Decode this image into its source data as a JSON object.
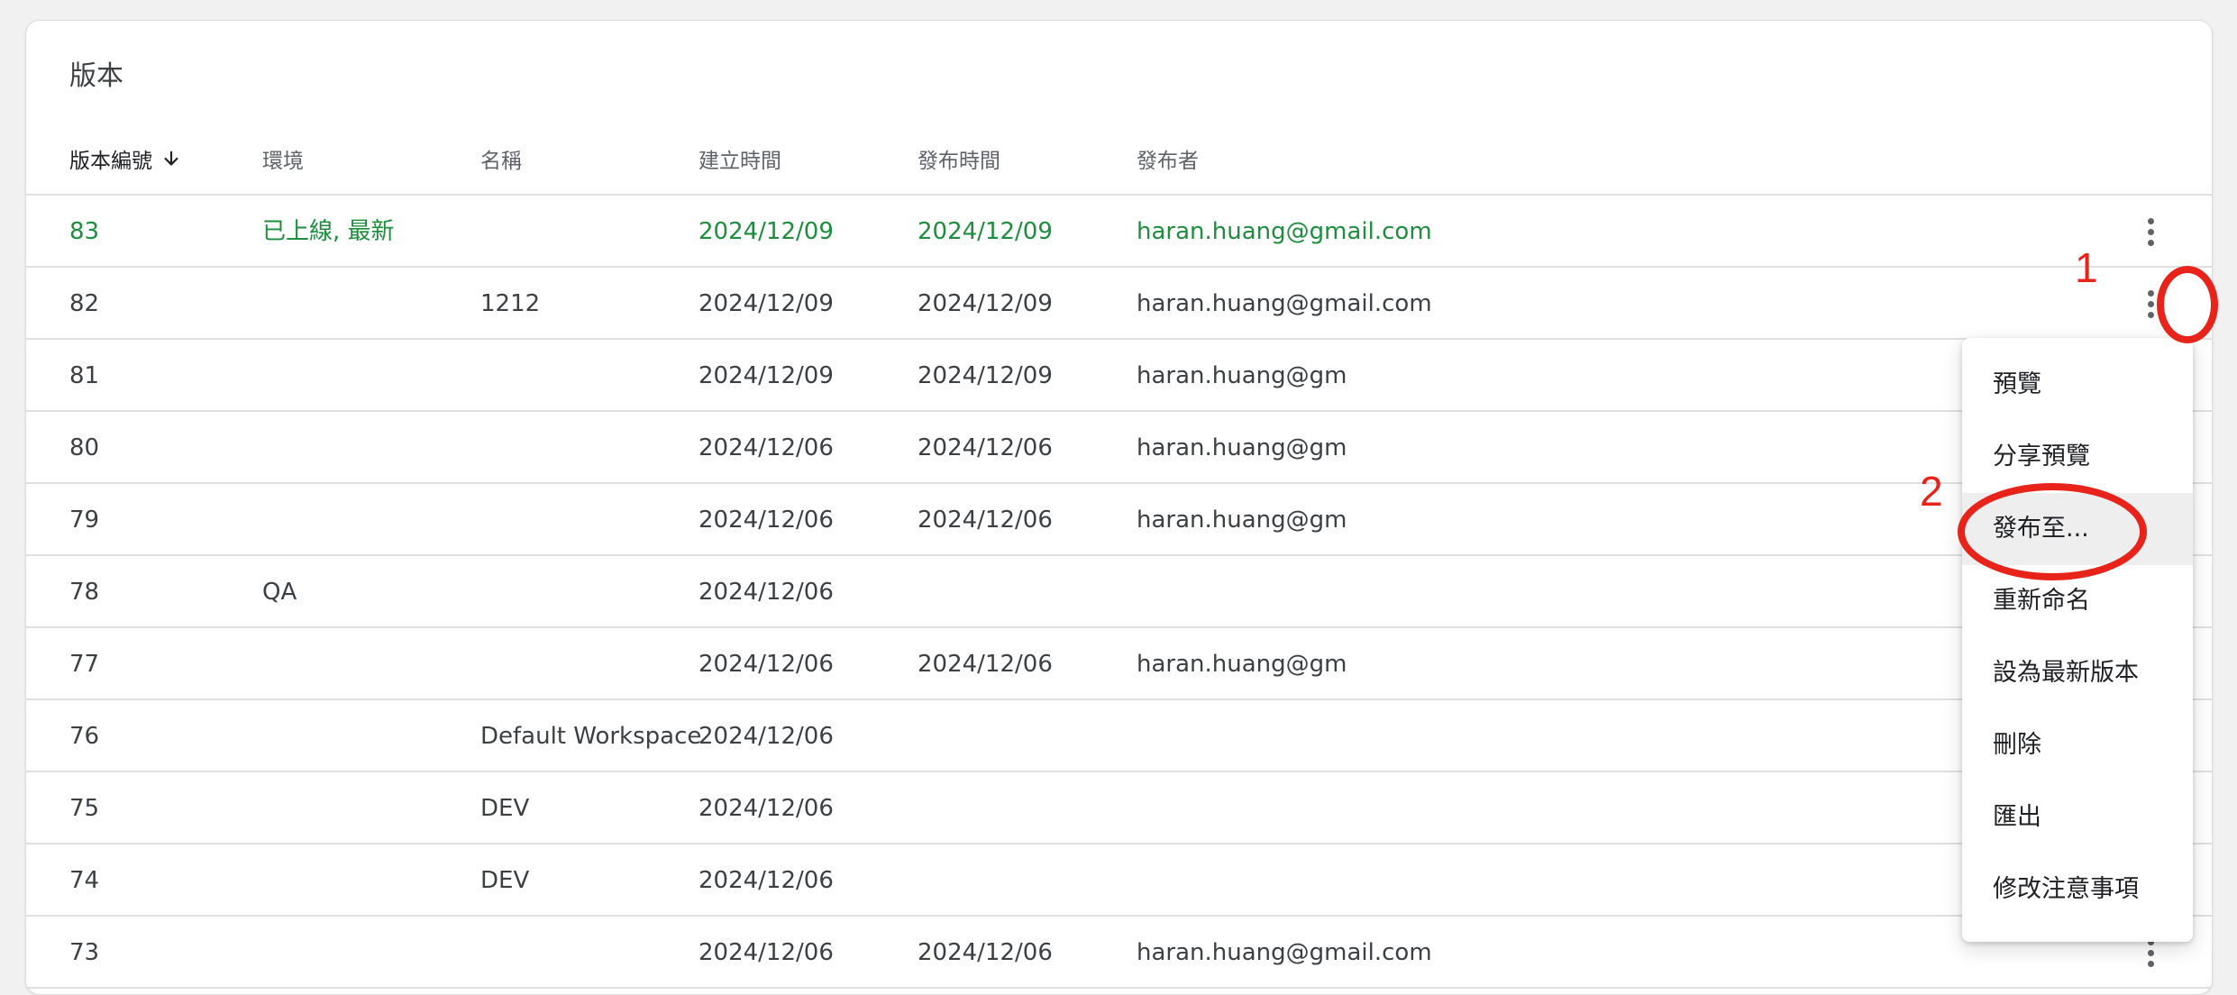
{
  "section_title": "版本",
  "columns": {
    "version": "版本編號",
    "env": "環境",
    "name": "名稱",
    "created": "建立時間",
    "published": "發布時間",
    "publisher": "發布者"
  },
  "rows": [
    {
      "version": "83",
      "env": "已上線, 最新",
      "name": "",
      "created": "2024/12/09",
      "published": "2024/12/09",
      "publisher": "haran.huang@gmail.com",
      "live": true
    },
    {
      "version": "82",
      "env": "",
      "name": "1212",
      "created": "2024/12/09",
      "published": "2024/12/09",
      "publisher": "haran.huang@gmail.com"
    },
    {
      "version": "81",
      "env": "",
      "name": "",
      "created": "2024/12/09",
      "published": "2024/12/09",
      "publisher": "haran.huang@gm"
    },
    {
      "version": "80",
      "env": "",
      "name": "",
      "created": "2024/12/06",
      "published": "2024/12/06",
      "publisher": "haran.huang@gm"
    },
    {
      "version": "79",
      "env": "",
      "name": "",
      "created": "2024/12/06",
      "published": "2024/12/06",
      "publisher": "haran.huang@gm"
    },
    {
      "version": "78",
      "env": "QA",
      "name": "",
      "created": "2024/12/06",
      "published": "",
      "publisher": ""
    },
    {
      "version": "77",
      "env": "",
      "name": "",
      "created": "2024/12/06",
      "published": "2024/12/06",
      "publisher": "haran.huang@gm"
    },
    {
      "version": "76",
      "env": "",
      "name": "Default Workspace",
      "created": "2024/12/06",
      "published": "",
      "publisher": ""
    },
    {
      "version": "75",
      "env": "",
      "name": "DEV",
      "created": "2024/12/06",
      "published": "",
      "publisher": ""
    },
    {
      "version": "74",
      "env": "",
      "name": "DEV",
      "created": "2024/12/06",
      "published": "",
      "publisher": ""
    },
    {
      "version": "73",
      "env": "",
      "name": "",
      "created": "2024/12/06",
      "published": "2024/12/06",
      "publisher": "haran.huang@gmail.com"
    }
  ],
  "menu": {
    "items": [
      "預覽",
      "分享預覽",
      "發布至...",
      "重新命名",
      "設為最新版本",
      "刪除",
      "匯出",
      "修改注意事項"
    ]
  },
  "annotations": {
    "first": "1",
    "second": "2"
  },
  "colors": {
    "live": "#1e8e3e",
    "annotation": "#e8231a"
  },
  "icons": {
    "sort": "arrow-down-icon",
    "row_menu": "more-vert-icon"
  }
}
